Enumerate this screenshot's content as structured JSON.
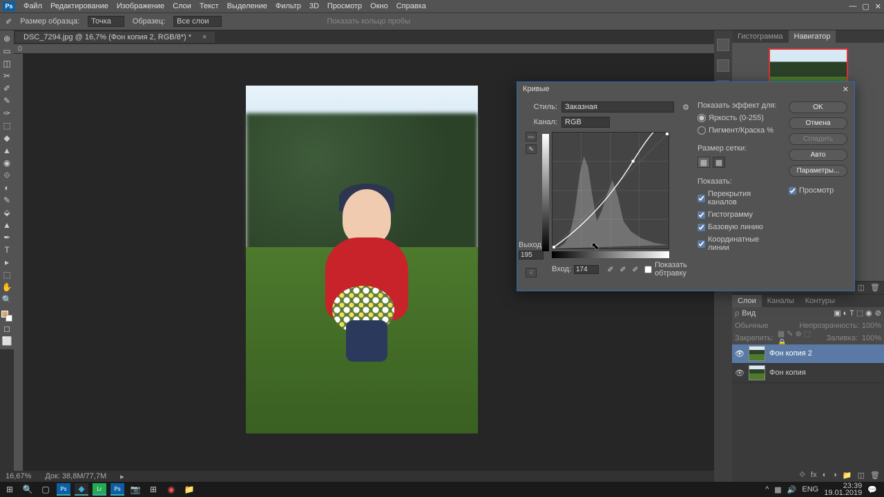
{
  "menu": {
    "items": [
      "Файл",
      "Редактирование",
      "Изображение",
      "Слои",
      "Текст",
      "Выделение",
      "Фильтр",
      "3D",
      "Просмотр",
      "Окно",
      "Справка"
    ]
  },
  "optionbar": {
    "sample_label": "Размер образца:",
    "sample_value": "Точка",
    "layer_label": "Образец:",
    "layer_value": "Все слои",
    "ring_label": "Показать кольцо пробы"
  },
  "doctab": {
    "title": "DSC_7294.jpg @ 16,7% (Фон копия 2, RGB/8*) *"
  },
  "tools": [
    "⊕",
    "▭",
    "◫",
    "⊘",
    "✎",
    "▤",
    "✆",
    "✑",
    "◆",
    "▲",
    "⊗",
    "◉",
    "⬚",
    "◐",
    "⟐",
    "A",
    "T",
    "▸",
    "✋",
    "⤢",
    "Q",
    "⟲"
  ],
  "dialog": {
    "title": "Кривые",
    "style_label": "Стиль:",
    "style_value": "Заказная",
    "channel_label": "Канал:",
    "channel_value": "RGB",
    "output_label": "Выход:",
    "output_value": "195",
    "input_label": "Вход:",
    "input_value": "174",
    "show_clipping": "Показать обтравку",
    "effect_label": "Показать эффект для:",
    "brightness": "Яркость (0-255)",
    "pigment": "Пигмент/Краска %",
    "grid_label": "Размер сетки:",
    "show_label": "Показать:",
    "chk_channels": "Перекрытия каналов",
    "chk_histogram": "Гистограмму",
    "chk_baseline": "Базовую линию",
    "chk_intersection": "Координатные линии",
    "ok": "OK",
    "cancel": "Отмена",
    "smooth": "Сгладить",
    "auto": "Авто",
    "options": "Параметры...",
    "preview": "Просмотр"
  },
  "panels": {
    "nav_tabs": [
      "Гистограмма",
      "Навигатор"
    ],
    "layer_tabs": [
      "Слои",
      "Каналы",
      "Контуры"
    ],
    "filter_label": "Вид",
    "blend_mode": "Обычные",
    "opacity_label": "Непрозрачность:",
    "opacity_value": "100%",
    "lock_label": "Закрепить:",
    "fill_label": "Заливка:",
    "fill_value": "100%",
    "layers": [
      {
        "name": "Фон копия 2",
        "selected": true
      },
      {
        "name": "Фон копия",
        "selected": false
      }
    ]
  },
  "status": {
    "zoom": "16,67%",
    "doc": "Док: 38,8M/77,7M"
  },
  "taskbar": {
    "lang": "ENG",
    "time": "23:39",
    "date": "19.01.2019"
  }
}
